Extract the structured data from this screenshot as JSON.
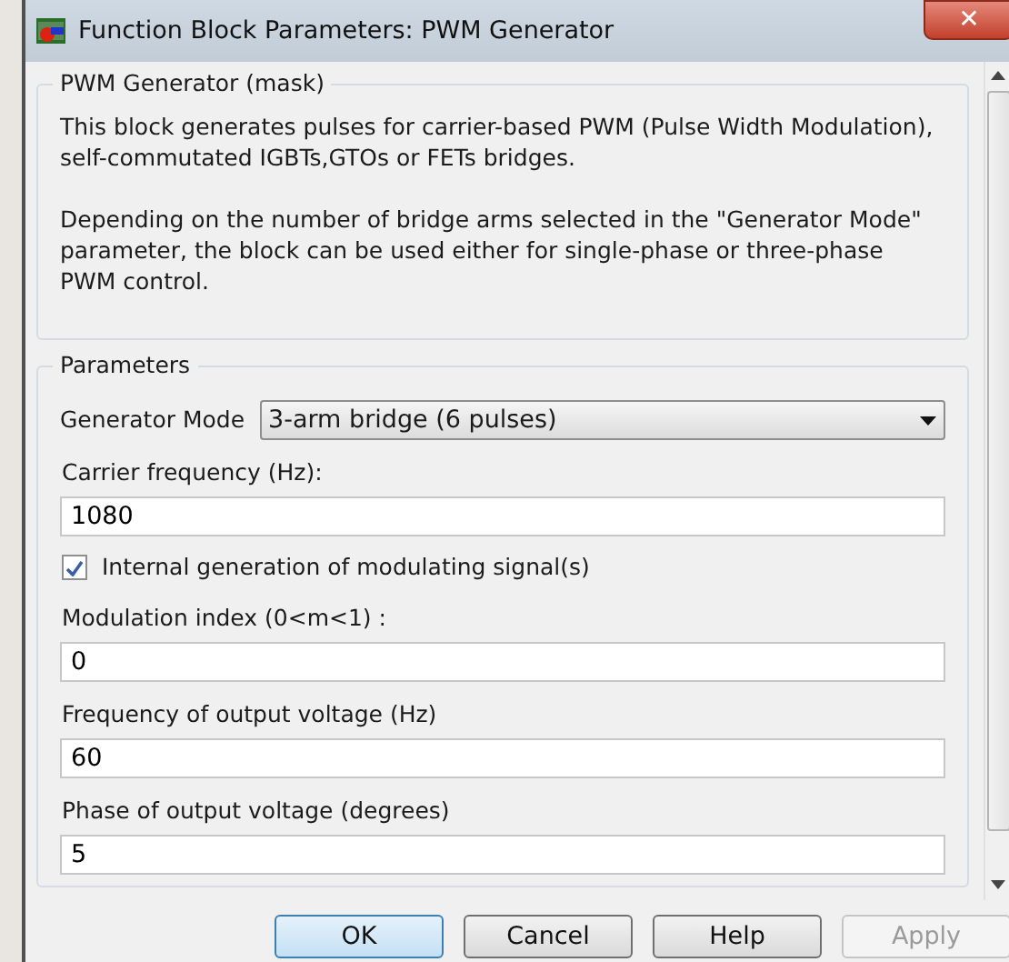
{
  "window": {
    "title": "Function Block Parameters: PWM Generator",
    "close_label": "✕"
  },
  "mask": {
    "title": "PWM Generator (mask)",
    "paragraphs": [
      "This block generates pulses for carrier-based PWM (Pulse Width Modulation), self-commutated IGBTs,GTOs or FETs bridges.",
      "Depending on the number of bridge arms selected in the \"Generator Mode\" parameter, the block can be used either for single-phase or three-phase PWM control."
    ]
  },
  "parameters": {
    "title": "Parameters",
    "items": [
      {
        "kind": "popup",
        "label": "Generator Mode",
        "value": "3-arm  bridge (6 pulses)"
      },
      {
        "kind": "edit",
        "label": "Carrier frequency (Hz):",
        "value": "1080"
      },
      {
        "kind": "checkbox",
        "label": "Internal generation of modulating signal(s)",
        "checked": true
      },
      {
        "kind": "edit",
        "label": "Modulation index  (0<m<1) :",
        "value": "0"
      },
      {
        "kind": "edit",
        "label": "Frequency of output voltage (Hz)",
        "value": "60"
      },
      {
        "kind": "edit",
        "label": "Phase of output voltage (degrees)",
        "value": "5"
      }
    ]
  },
  "buttons": [
    {
      "label": "OK",
      "default": true,
      "disabled": false
    },
    {
      "label": "Cancel",
      "default": false,
      "disabled": false
    },
    {
      "label": "Help",
      "default": false,
      "disabled": false
    },
    {
      "label": "Apply",
      "default": false,
      "disabled": true
    }
  ]
}
